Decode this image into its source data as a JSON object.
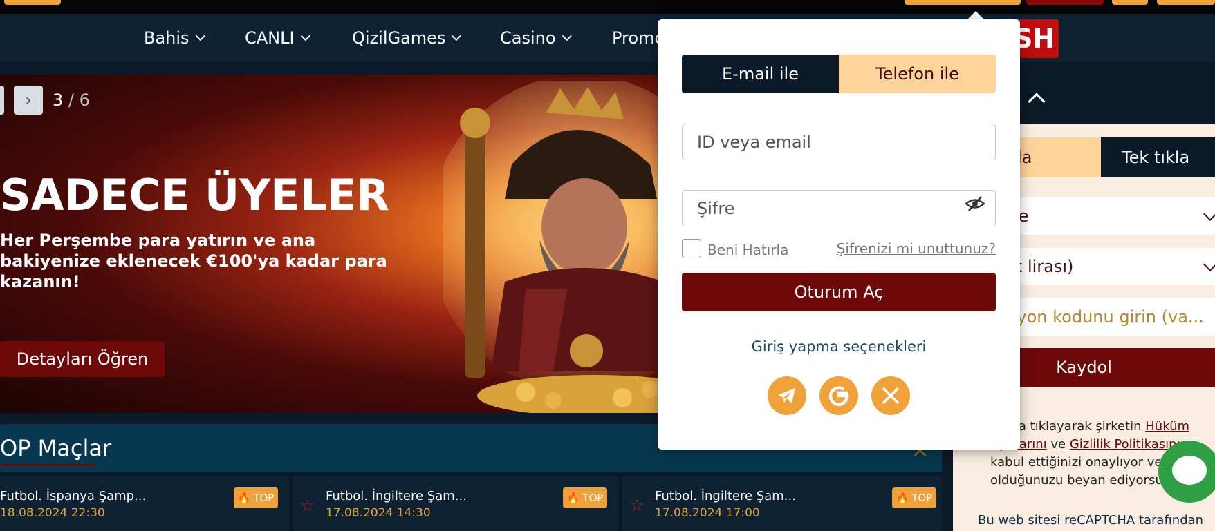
{
  "nav": {
    "items": [
      {
        "label": "Bahis"
      },
      {
        "label": "CANLI"
      },
      {
        "label": "QizilGames"
      },
      {
        "label": "Casino"
      },
      {
        "label": "Promo"
      }
    ],
    "brand_fragment": "SH"
  },
  "banner": {
    "counter_current": "3",
    "counter_sep": "/",
    "counter_total": "6",
    "title": "SADECE ÜYELER",
    "subtitle": "Her Perşembe para yatırın ve ana bakiyenize eklenecek €100'ya kadar para kazanın!",
    "cta": "Detayları Öğren"
  },
  "matches": {
    "title": "OP Maçlar",
    "badge": "TOP",
    "items": [
      {
        "title": "Futbol. İspanya Şamp...",
        "date": "18.08.2024 22:30"
      },
      {
        "title": "Futbol. İngiltere Şam...",
        "date": "17.08.2024 14:30"
      },
      {
        "title": "Futbol. İngiltere Şam...",
        "date": "17.08.2024 17:00"
      }
    ]
  },
  "register": {
    "tab_phone": "efonla",
    "tab_oneclick": "Tek tıkla",
    "country": "rkiye",
    "currency": "Türk lirası)",
    "promo": "nosyon kodunu girin (va...",
    "submit": "Kaydol",
    "legal_1": "utona tıklayarak şirketin ",
    "legal_link1": "Hüküm",
    "legal_link2": "oşullarını",
    "legal_and": " ve ",
    "legal_link3": "Gizlilik Politikasını",
    "legal_2": "kabul ettiğinizi onaylıyor ve",
    "legal_3": "olduğunuzu beyan ediyorsu",
    "recaptcha": "Bu web sitesi reCAPTCHA tarafından"
  },
  "login": {
    "tab_email": "E-mail ile",
    "tab_phone": "Telefon ile",
    "id_placeholder": "ID veya email",
    "password_placeholder": "Şifre",
    "remember": "Beni Hatırla",
    "forgot": "Şifrenizi mi unuttunuz?",
    "submit": "Oturum Aç",
    "options": "Giriş yapma seçenekleri",
    "social": [
      "telegram-icon",
      "google-icon",
      "x-icon"
    ]
  },
  "colors": {
    "navy": "#0b1a28",
    "maroon": "#6e0909",
    "peach": "#fed49b",
    "gold": "#f0a23a"
  }
}
